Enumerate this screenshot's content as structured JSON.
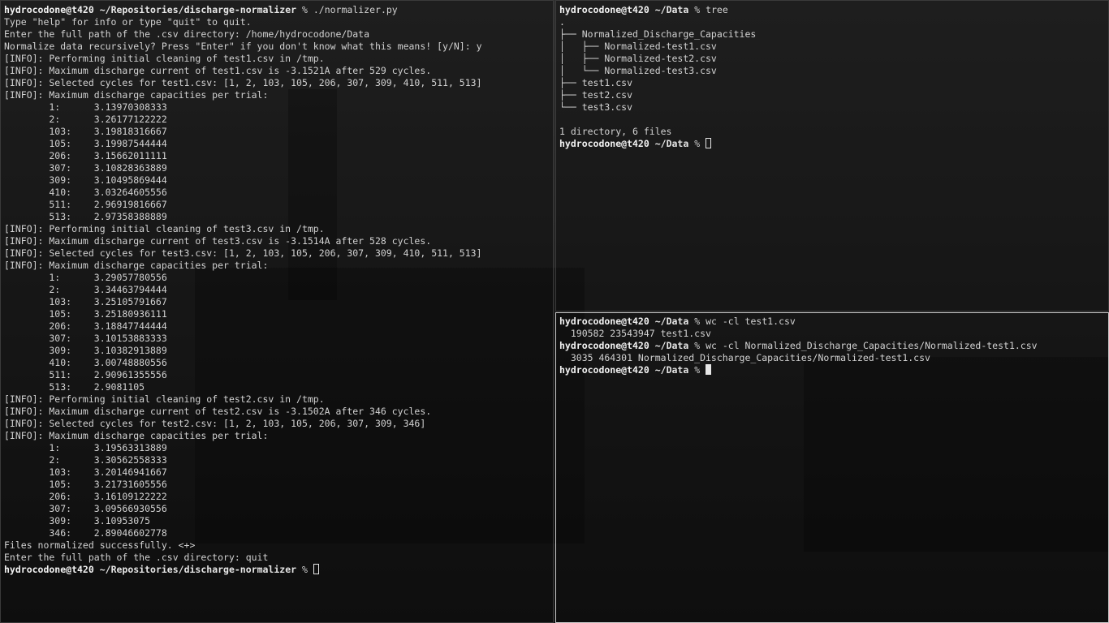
{
  "left": {
    "prompt": {
      "user": "hydrocodone@t420",
      "path": "~/Repositories/discharge-normalizer",
      "symbol": "%",
      "command": "./normalizer.py"
    },
    "output": [
      "Type \"help\" for info or type \"quit\" to quit.",
      "Enter the full path of the .csv directory: /home/hydrocodone/Data",
      "Normalize data recursively? Press \"Enter\" if you don't know what this means! [y/N]: y",
      "[INFO]: Performing initial cleaning of test1.csv in /tmp.",
      "[INFO]: Maximum discharge current of test1.csv is -3.1521A after 529 cycles.",
      "[INFO]: Selected cycles for test1.csv: [1, 2, 103, 105, 206, 307, 309, 410, 511, 513]",
      "[INFO]: Maximum discharge capacities per trial:",
      "        1:      3.13970308333",
      "        2:      3.26177122222",
      "        103:    3.19818316667",
      "        105:    3.19987544444",
      "        206:    3.15662011111",
      "        307:    3.10828363889",
      "        309:    3.10495869444",
      "        410:    3.03264605556",
      "        511:    2.96919816667",
      "        513:    2.97358388889",
      "[INFO]: Performing initial cleaning of test3.csv in /tmp.",
      "[INFO]: Maximum discharge current of test3.csv is -3.1514A after 528 cycles.",
      "[INFO]: Selected cycles for test3.csv: [1, 2, 103, 105, 206, 307, 309, 410, 511, 513]",
      "[INFO]: Maximum discharge capacities per trial:",
      "        1:      3.29057780556",
      "        2:      3.34463794444",
      "        103:    3.25105791667",
      "        105:    3.25180936111",
      "        206:    3.18847744444",
      "        307:    3.10153883333",
      "        309:    3.10382913889",
      "        410:    3.00748880556",
      "        511:    2.90961355556",
      "        513:    2.9081105",
      "[INFO]: Performing initial cleaning of test2.csv in /tmp.",
      "[INFO]: Maximum discharge current of test2.csv is -3.1502A after 346 cycles.",
      "[INFO]: Selected cycles for test2.csv: [1, 2, 103, 105, 206, 307, 309, 346]",
      "[INFO]: Maximum discharge capacities per trial:",
      "        1:      3.19563313889",
      "        2:      3.30562558333",
      "        103:    3.20146941667",
      "        105:    3.21731605556",
      "        206:    3.16109122222",
      "        307:    3.09566930556",
      "        309:    3.10953075",
      "        346:    2.89046602778",
      "Files normalized successfully. <+>",
      "Enter the full path of the .csv directory: quit"
    ],
    "final_prompt": {
      "user": "hydrocodone@t420",
      "path": "~/Repositories/discharge-normalizer",
      "symbol": "%"
    }
  },
  "top_right": {
    "prompt": {
      "user": "hydrocodone@t420",
      "path": "~/Data",
      "symbol": "%",
      "command": "tree"
    },
    "output": [
      ".",
      "├── Normalized_Discharge_Capacities",
      "│   ├── Normalized-test1.csv",
      "│   ├── Normalized-test2.csv",
      "│   └── Normalized-test3.csv",
      "├── test1.csv",
      "├── test2.csv",
      "└── test3.csv",
      "",
      "1 directory, 6 files"
    ],
    "final_prompt": {
      "user": "hydrocodone@t420",
      "path": "~/Data",
      "symbol": "%"
    }
  },
  "bottom_right": {
    "prompt1": {
      "user": "hydrocodone@t420",
      "path": "~/Data",
      "symbol": "%",
      "command": "wc -cl test1.csv"
    },
    "output1": "  190582 23543947 test1.csv",
    "prompt2": {
      "user": "hydrocodone@t420",
      "path": "~/Data",
      "symbol": "%",
      "command": "wc -cl Normalized_Discharge_Capacities/Normalized-test1.csv"
    },
    "output2": "  3035 464301 Normalized_Discharge_Capacities/Normalized-test1.csv",
    "final_prompt": {
      "user": "hydrocodone@t420",
      "path": "~/Data",
      "symbol": "%"
    }
  }
}
